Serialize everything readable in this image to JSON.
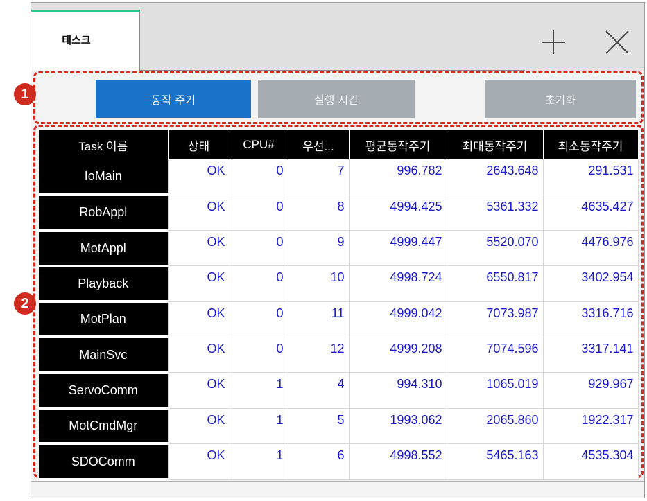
{
  "tab": {
    "label": "태스크"
  },
  "toolbar": {
    "add_icon": "plus-icon",
    "close_icon": "close-icon",
    "buttons": [
      {
        "label": "동작 주기",
        "active": true
      },
      {
        "label": "실행 시간",
        "active": false
      },
      {
        "label": "초기화",
        "active": false
      }
    ]
  },
  "annotations": {
    "badge1": "1",
    "badge2": "2",
    "color": "#cf2b1e"
  },
  "table": {
    "columns": [
      "Task 이름",
      "상태",
      "CPU#",
      "우선...",
      "평균동작주기",
      "최대동작주기",
      "최소동작주기"
    ],
    "rows": [
      {
        "name": "IoMain",
        "status": "OK",
        "cpu": "0",
        "priority": "7",
        "avg": "996.782",
        "max": "2643.648",
        "min": "291.531"
      },
      {
        "name": "RobAppl",
        "status": "OK",
        "cpu": "0",
        "priority": "8",
        "avg": "4994.425",
        "max": "5361.332",
        "min": "4635.427"
      },
      {
        "name": "MotAppl",
        "status": "OK",
        "cpu": "0",
        "priority": "9",
        "avg": "4999.447",
        "max": "5520.070",
        "min": "4476.976"
      },
      {
        "name": "Playback",
        "status": "OK",
        "cpu": "0",
        "priority": "10",
        "avg": "4998.724",
        "max": "6550.817",
        "min": "3402.954"
      },
      {
        "name": "MotPlan",
        "status": "OK",
        "cpu": "0",
        "priority": "11",
        "avg": "4999.042",
        "max": "7073.987",
        "min": "3316.716"
      },
      {
        "name": "MainSvc",
        "status": "OK",
        "cpu": "0",
        "priority": "12",
        "avg": "4999.208",
        "max": "7074.596",
        "min": "3317.141"
      },
      {
        "name": "ServoComm",
        "status": "OK",
        "cpu": "1",
        "priority": "4",
        "avg": "994.310",
        "max": "1065.019",
        "min": "929.967"
      },
      {
        "name": "MotCmdMgr",
        "status": "OK",
        "cpu": "1",
        "priority": "5",
        "avg": "1993.062",
        "max": "2065.860",
        "min": "1922.317"
      },
      {
        "name": "SDOComm",
        "status": "OK",
        "cpu": "1",
        "priority": "6",
        "avg": "4998.552",
        "max": "5465.163",
        "min": "4535.304"
      }
    ]
  },
  "colors": {
    "accent": "#1a73c9",
    "value_text": "#1a1acc",
    "tab_indicator": "#1fc98a"
  }
}
